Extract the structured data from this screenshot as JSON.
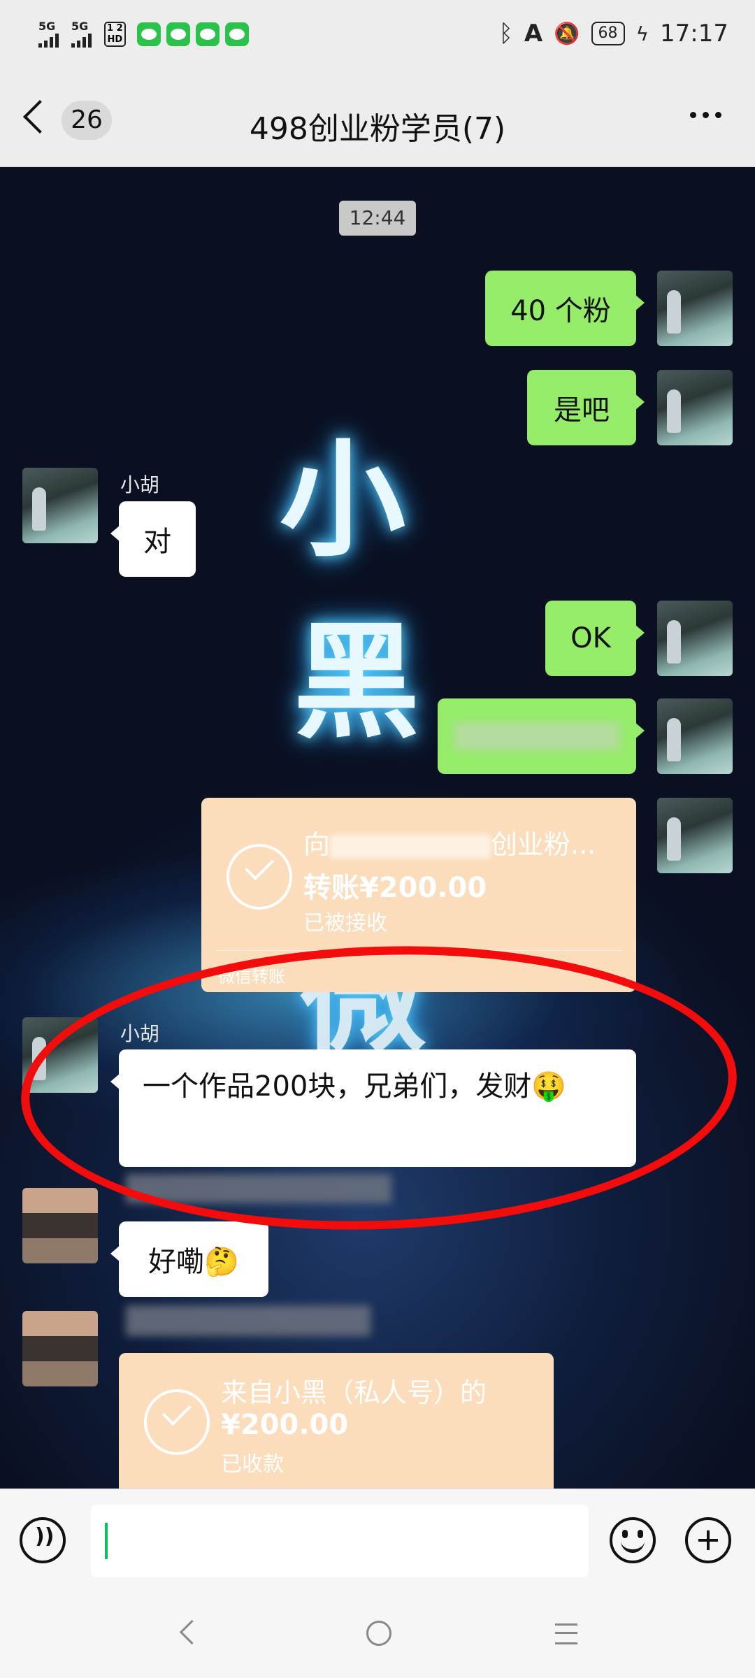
{
  "status_bar": {
    "signal1": "5G",
    "signal2": "5G",
    "hd_top": "1 2",
    "hd_bottom": "HD",
    "battery": "68",
    "time": "17:17"
  },
  "header": {
    "back_count": "26",
    "title": "498创业粉学员(7)"
  },
  "chat": {
    "timestamp": "12:44",
    "background_text": [
      "小",
      "黑",
      "微"
    ],
    "messages": [
      {
        "side": "right",
        "text": "40 个粉"
      },
      {
        "side": "right",
        "text": "是吧"
      },
      {
        "side": "left",
        "sender": "小胡",
        "text": "对"
      },
      {
        "side": "right",
        "text": "OK"
      },
      {
        "side": "right",
        "text": ""
      },
      {
        "side": "right",
        "type": "transfer",
        "title_prefix": "向",
        "title_suffix": "创业粉...",
        "amount": "转账¥200.00",
        "status": "已被接收",
        "footer": "微信转账"
      },
      {
        "side": "left",
        "sender": "小胡",
        "text": "一个作品200块，兄弟们，发财🤑"
      },
      {
        "side": "left",
        "sender": "",
        "text": "好嘞🤔"
      },
      {
        "side": "left",
        "type": "transfer",
        "title": "来自小黑（私人号）的",
        "amount": "¥200.00",
        "status": "已收款"
      }
    ]
  },
  "colors": {
    "green_bubble": "#95ec69",
    "transfer_card": "#fbdcbb",
    "red_annotation": "#f20c0c",
    "cursor": "#07c160"
  }
}
